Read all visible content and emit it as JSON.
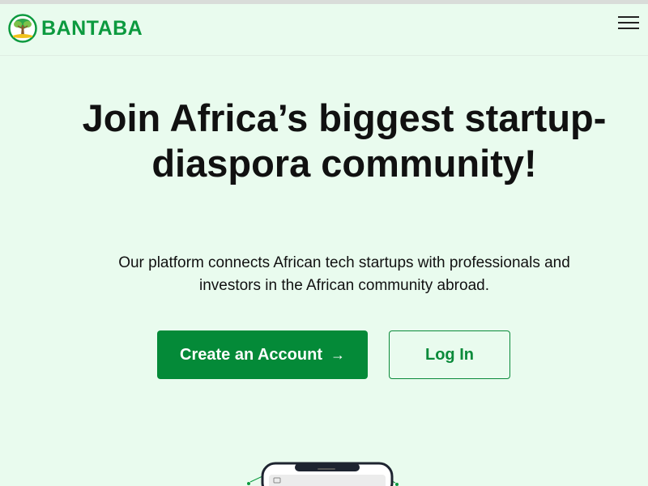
{
  "header": {
    "brand": "BANTABA",
    "logo_icon": "tree-logo-icon",
    "menu_icon": "hamburger-menu-icon"
  },
  "hero": {
    "title": "Join Africa’s biggest startup-diaspora community!",
    "subtitle": "Our platform connects African tech startups with professionals and investors in the African community abroad.",
    "primary_button": "Create an Account",
    "primary_button_icon": "arrow-right-icon",
    "secondary_button": "Log In"
  },
  "illustration": {
    "icon": "phone-mockup-icon"
  },
  "colors": {
    "background": "#e9fbee",
    "brand": "#0c9a3f",
    "primary_button": "#048a38",
    "text": "#111111"
  }
}
